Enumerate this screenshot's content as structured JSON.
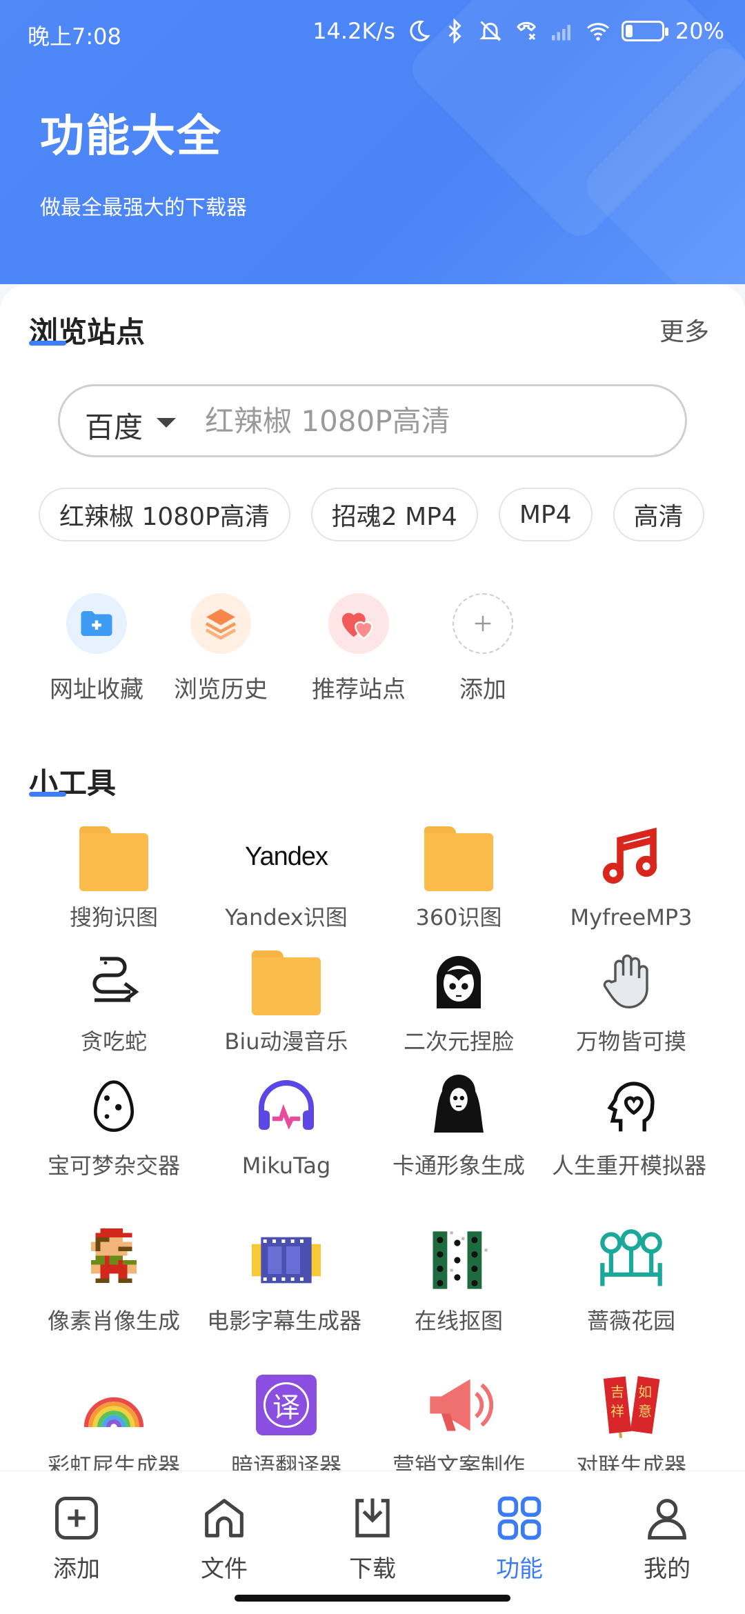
{
  "status_bar": {
    "time": "晚上7:08",
    "network_speed": "14.2K/s",
    "battery_percent": "20%",
    "battery_level": 0.2
  },
  "header": {
    "title": "功能大全",
    "subtitle": "做最全最强大的下载器"
  },
  "browse": {
    "section_title": "浏览站点",
    "more_label": "更多",
    "search": {
      "engine": "百度",
      "placeholder": "红辣椒 1080P高清"
    },
    "chips": [
      "红辣椒 1080P高清",
      "招魂2 MP4",
      "MP4",
      "高清"
    ],
    "quick_links": [
      {
        "label": "网址收藏",
        "icon": "folder-plus-icon"
      },
      {
        "label": "浏览历史",
        "icon": "layers-icon"
      },
      {
        "label": "推荐站点",
        "icon": "hearts-icon"
      },
      {
        "label": "添加",
        "icon": "plus-icon"
      }
    ]
  },
  "tools": {
    "section_title": "小工具",
    "items": [
      {
        "label": "搜狗识图",
        "icon": "folder-icon"
      },
      {
        "label": "Yandex识图",
        "icon": "yandex-logo-icon",
        "logo_text": "Yandex"
      },
      {
        "label": "360识图",
        "icon": "folder-icon"
      },
      {
        "label": "MyfreeMP3",
        "icon": "music-note-icon"
      },
      {
        "label": "贪吃蛇",
        "icon": "snake-icon"
      },
      {
        "label": "Biu动漫音乐",
        "icon": "folder-icon"
      },
      {
        "label": "二次元捏脸",
        "icon": "anime-face-icon"
      },
      {
        "label": "万物皆可摸",
        "icon": "hand-icon"
      },
      {
        "label": "宝可梦杂交器",
        "icon": "egg-icon"
      },
      {
        "label": "MikuTag",
        "icon": "headphones-icon"
      },
      {
        "label": "卡通形象生成",
        "icon": "ghost-mask-icon"
      },
      {
        "label": "人生重开模拟器",
        "icon": "head-heart-icon"
      },
      {
        "label": "像素肖像生成",
        "icon": "pixel-mario-icon"
      },
      {
        "label": "电影字幕生成器",
        "icon": "film-strip-icon"
      },
      {
        "label": "在线抠图",
        "icon": "cutout-grid-icon"
      },
      {
        "label": "蔷薇花园",
        "icon": "garden-icon"
      },
      {
        "label": "彩虹屁生成器",
        "icon": "rainbow-icon"
      },
      {
        "label": "暗语翻译器",
        "icon": "translate-icon",
        "logo_text": "译"
      },
      {
        "label": "营销文案制作",
        "icon": "megaphone-icon"
      },
      {
        "label": "对联生成器",
        "icon": "couplet-icon",
        "logo_text": "吉祥如意"
      }
    ]
  },
  "bottom_nav": {
    "items": [
      {
        "label": "添加",
        "icon": "add-square-icon"
      },
      {
        "label": "文件",
        "icon": "home-file-icon"
      },
      {
        "label": "下载",
        "icon": "download-icon"
      },
      {
        "label": "功能",
        "icon": "grid-icon",
        "active": true
      },
      {
        "label": "我的",
        "icon": "user-icon"
      }
    ]
  },
  "colors": {
    "header_blue": "#4a84f6",
    "accent_blue": "#3b7cf4",
    "folder_yellow": "#fbbc4b"
  }
}
